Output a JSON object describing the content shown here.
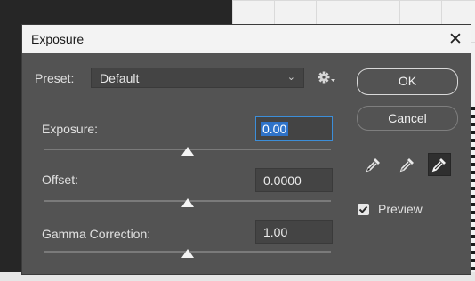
{
  "dialog": {
    "title": "Exposure",
    "close_glyph": "✕"
  },
  "preset": {
    "label": "Preset:",
    "value": "Default",
    "chevron": "⌄",
    "gear_icon": "gear-icon"
  },
  "buttons": {
    "ok": "OK",
    "cancel": "Cancel"
  },
  "fields": [
    {
      "label": "Exposure:",
      "value": "0.00",
      "focused": true,
      "slider_fraction": 0.5
    },
    {
      "label": "Offset:",
      "value": "0.0000",
      "focused": false,
      "slider_fraction": 0.5
    },
    {
      "label": "Gamma Correction:",
      "value": "1.00",
      "focused": false,
      "slider_fraction": 0.5
    }
  ],
  "eyedroppers": [
    {
      "icon": "black-point-eyedropper-icon",
      "active": false
    },
    {
      "icon": "gray-point-eyedropper-icon",
      "active": false
    },
    {
      "icon": "white-point-eyedropper-icon",
      "active": true
    }
  ],
  "preview": {
    "label": "Preview",
    "checked": true
  },
  "colors": {
    "dialog_bg": "#535353",
    "field_bg": "#444444",
    "focus_blue": "#3c8ed9",
    "selection_blue": "#2f73c9"
  }
}
